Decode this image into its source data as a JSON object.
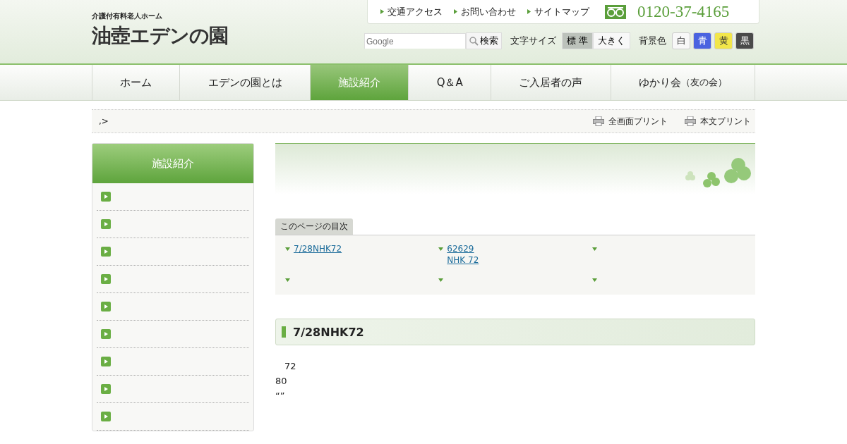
{
  "header": {
    "tagline": "介護付有料老人ホーム",
    "logo": "油壺エデンの園",
    "links": [
      "交通アクセス",
      "お問い合わせ",
      "サイトマップ"
    ],
    "phone": "0120-37-4165",
    "search": {
      "placeholder": "Google",
      "button": "検索"
    },
    "font_size": {
      "label": "文字サイズ",
      "options": [
        {
          "label": "標 準",
          "selected": true
        },
        {
          "label": "大きく",
          "selected": false
        }
      ]
    },
    "bg_color": {
      "label": "背景色",
      "options": [
        {
          "label": "白",
          "color": "#f8f8f8"
        },
        {
          "label": "青",
          "color": "#4a63e0"
        },
        {
          "label": "黄",
          "color": "#f2e64a"
        },
        {
          "label": "黒",
          "color": "#4a4a4a"
        }
      ]
    }
  },
  "nav": [
    {
      "label": "ホーム",
      "selected": false
    },
    {
      "label": "エデンの園とは",
      "selected": false
    },
    {
      "label": "施設紹介",
      "selected": true
    },
    {
      "label": "Q＆A",
      "selected": false
    },
    {
      "label": "ご入居者の声",
      "selected": false
    },
    {
      "label": "ゆかり会",
      "note": "（友の会）",
      "selected": false
    }
  ],
  "breadcrumb": ",>",
  "print_links": [
    "全画面プリント",
    "本文プリント"
  ],
  "sidebar": {
    "title": "施設紹介",
    "items": [
      {
        "kind": "link"
      },
      {
        "kind": "link"
      },
      {
        "kind": "link"
      },
      {
        "kind": "link"
      },
      {
        "kind": "link"
      },
      {
        "kind": "link"
      },
      {
        "kind": "link"
      },
      {
        "kind": "link"
      },
      {
        "kind": "link"
      }
    ]
  },
  "toc": {
    "title": "このページの目次",
    "items": [
      {
        "kind": "link",
        "lines": [
          "7/28NHK72"
        ]
      },
      {
        "kind": "link",
        "lines": [
          "62629",
          "NHK 72"
        ]
      },
      {
        "kind": "link"
      },
      {
        "kind": "link"
      },
      {
        "kind": "link"
      },
      {
        "kind": "link"
      }
    ]
  },
  "section": {
    "heading": "7/28NHK72",
    "paragraphs": [
      "72",
      "80",
      "“”"
    ]
  }
}
